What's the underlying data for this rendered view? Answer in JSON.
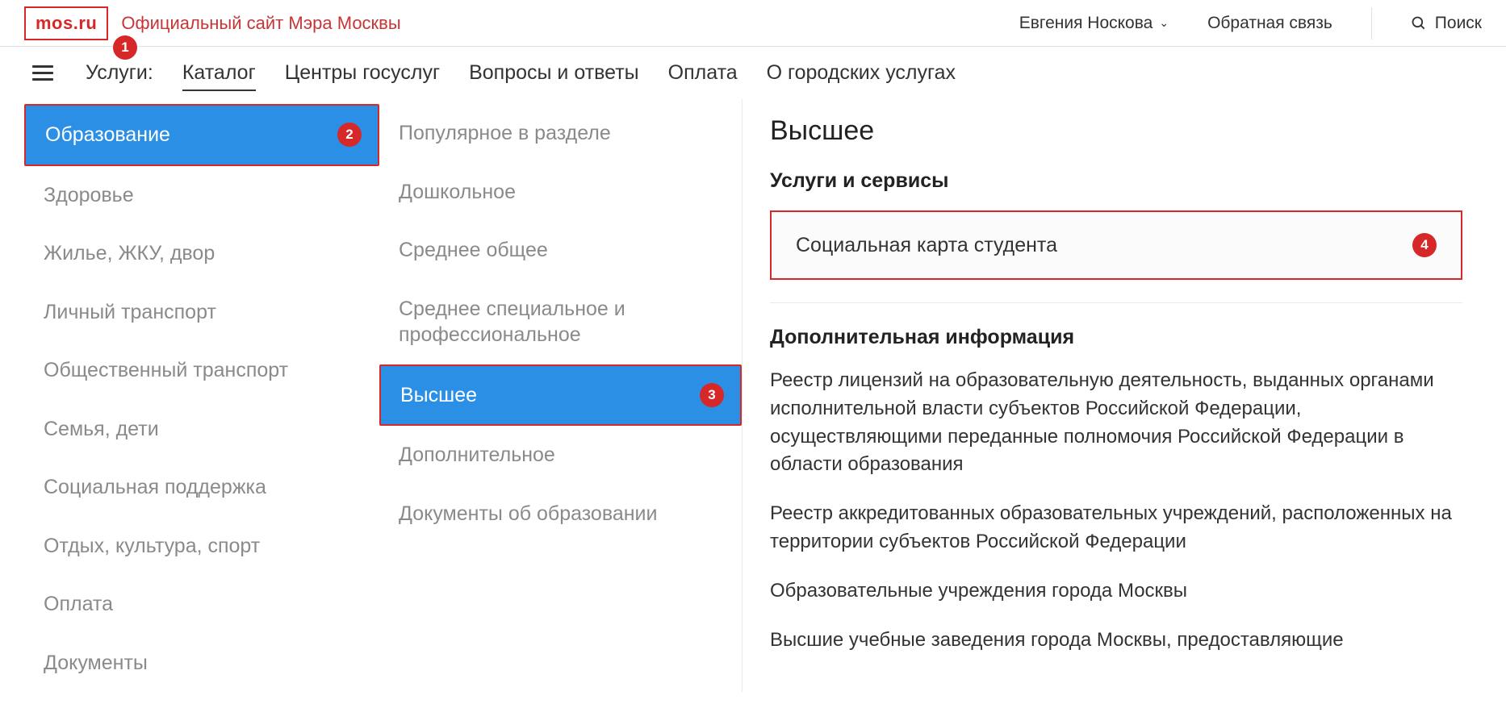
{
  "header": {
    "logo": "mos.ru",
    "subtitle": "Официальный сайт Мэра Москвы",
    "user_name": "Евгения Носкова",
    "feedback": "Обратная связь",
    "search": "Поиск"
  },
  "nav": {
    "label": "Услуги:",
    "items": [
      "Каталог",
      "Центры госуслуг",
      "Вопросы и ответы",
      "Оплата",
      "О городских услугах"
    ],
    "active_index": 0
  },
  "annotations": {
    "b1": "1",
    "b2": "2",
    "b3": "3",
    "b4": "4"
  },
  "categories": {
    "items": [
      "Образование",
      "Здоровье",
      "Жилье, ЖКУ, двор",
      "Личный транспорт",
      "Общественный транспорт",
      "Семья, дети",
      "Социальная поддержка",
      "Отдых, культура, спорт",
      "Оплата",
      "Документы"
    ],
    "selected_index": 0
  },
  "subcategories": {
    "items": [
      "Популярное в разделе",
      "Дошкольное",
      "Среднее общее",
      "Среднее специальное и профессиональное",
      "Высшее",
      "Дополнительное",
      "Документы об образовании"
    ],
    "selected_index": 4
  },
  "details": {
    "title": "Высшее",
    "services_heading": "Услуги и сервисы",
    "service_item": "Социальная карта студента",
    "extra_heading": "Дополнительная информация",
    "paragraphs": [
      "Реестр лицензий на образовательную деятельность, выданных органами исполнительной власти субъектов Российской Федерации, осуществляющими переданные полномочия Российской Федерации в области образования",
      "Реестр аккредитованных образовательных учреждений, расположенных на территории субъектов Российской Федерации",
      "Образовательные учреждения города Москвы",
      "Высшие учебные заведения города Москвы, предоставляющие"
    ]
  }
}
